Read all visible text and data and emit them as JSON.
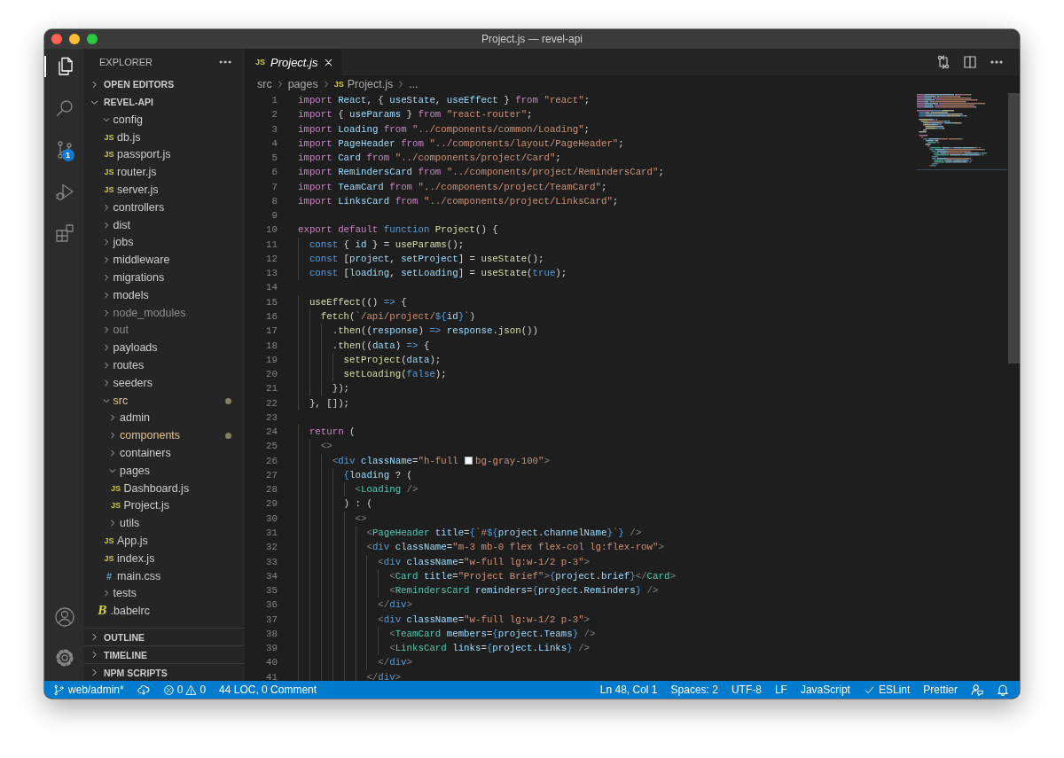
{
  "window": {
    "title": "Project.js — revel-api"
  },
  "activity_bar": {
    "items": [
      {
        "kind": "files",
        "selected": true
      },
      {
        "kind": "search",
        "selected": false
      },
      {
        "kind": "scm",
        "selected": false,
        "badge": "1"
      },
      {
        "kind": "debug",
        "selected": false
      },
      {
        "kind": "extensions",
        "selected": false
      }
    ],
    "bottom": [
      {
        "kind": "account"
      },
      {
        "kind": "settings"
      }
    ]
  },
  "sidebar": {
    "title": "EXPLORER",
    "sections": [
      {
        "title": "OPEN EDITORS",
        "expanded": false
      },
      {
        "title": "REVEL-API",
        "expanded": true,
        "tree": [
          {
            "name": "config",
            "kind": "folder",
            "expanded": true,
            "modified": false,
            "ignored": false,
            "children": [
              {
                "name": "db.js",
                "kind": "js",
                "icon": "JS",
                "modified": false,
                "ignored": false
              },
              {
                "name": "passport.js",
                "kind": "js",
                "icon": "JS",
                "modified": false,
                "ignored": false
              },
              {
                "name": "router.js",
                "kind": "js",
                "icon": "JS",
                "modified": false,
                "ignored": false
              },
              {
                "name": "server.js",
                "kind": "js",
                "icon": "JS",
                "modified": false,
                "ignored": false
              }
            ]
          },
          {
            "name": "controllers",
            "kind": "folder",
            "expanded": false,
            "modified": false,
            "ignored": false
          },
          {
            "name": "dist",
            "kind": "folder",
            "expanded": false,
            "modified": false,
            "ignored": false
          },
          {
            "name": "jobs",
            "kind": "folder",
            "expanded": false,
            "modified": false,
            "ignored": false
          },
          {
            "name": "middleware",
            "kind": "folder",
            "expanded": false,
            "modified": false,
            "ignored": false
          },
          {
            "name": "migrations",
            "kind": "folder",
            "expanded": false,
            "modified": false,
            "ignored": false
          },
          {
            "name": "models",
            "kind": "folder",
            "expanded": false,
            "modified": false,
            "ignored": false
          },
          {
            "name": "node_modules",
            "kind": "folder",
            "expanded": false,
            "modified": false,
            "ignored": true
          },
          {
            "name": "out",
            "kind": "folder",
            "expanded": false,
            "modified": false,
            "ignored": true
          },
          {
            "name": "payloads",
            "kind": "folder",
            "expanded": false,
            "modified": false,
            "ignored": false
          },
          {
            "name": "routes",
            "kind": "folder",
            "expanded": false,
            "modified": false,
            "ignored": false
          },
          {
            "name": "seeders",
            "kind": "folder",
            "expanded": false,
            "modified": false,
            "ignored": false
          },
          {
            "name": "src",
            "kind": "folder",
            "expanded": true,
            "modified": true,
            "ignored": false,
            "children": [
              {
                "name": "admin",
                "kind": "folder",
                "expanded": false,
                "modified": false,
                "ignored": false
              },
              {
                "name": "components",
                "kind": "folder",
                "expanded": false,
                "modified": true,
                "ignored": false
              },
              {
                "name": "containers",
                "kind": "folder",
                "expanded": false,
                "modified": false,
                "ignored": false
              },
              {
                "name": "pages",
                "kind": "folder",
                "expanded": true,
                "modified": false,
                "ignored": false,
                "children": [
                  {
                    "name": "Dashboard.js",
                    "kind": "js",
                    "icon": "JS",
                    "modified": false,
                    "ignored": false
                  },
                  {
                    "name": "Project.js",
                    "kind": "js",
                    "icon": "JS",
                    "modified": false,
                    "ignored": false
                  }
                ]
              },
              {
                "name": "utils",
                "kind": "folder",
                "expanded": false,
                "modified": false,
                "ignored": false
              },
              {
                "name": "App.js",
                "kind": "js",
                "icon": "JS",
                "modified": false,
                "ignored": false
              },
              {
                "name": "index.js",
                "kind": "js",
                "icon": "JS",
                "modified": false,
                "ignored": false
              },
              {
                "name": "main.css",
                "kind": "css",
                "icon": "#",
                "modified": false,
                "ignored": false
              }
            ]
          },
          {
            "name": "tests",
            "kind": "folder",
            "expanded": false,
            "modified": false,
            "ignored": false
          },
          {
            "name": ".babelrc",
            "kind": "babel",
            "icon": "B",
            "modified": false,
            "ignored": false
          }
        ]
      },
      {
        "title": "OUTLINE",
        "expanded": false
      },
      {
        "title": "TIMELINE",
        "expanded": false
      },
      {
        "title": "NPM SCRIPTS",
        "expanded": false
      }
    ]
  },
  "editor": {
    "tabs": [
      {
        "label": "Project.js",
        "icon": "JS",
        "selected": true,
        "preview": true
      }
    ],
    "actions": [
      {
        "kind": "compare"
      },
      {
        "kind": "split"
      },
      {
        "kind": "more"
      }
    ],
    "breadcrumbs": [
      {
        "label": "src"
      },
      {
        "label": "pages"
      },
      {
        "label": "Project.js",
        "icon": "JS"
      },
      {
        "label": "..."
      }
    ],
    "lines": [
      {
        "number": "1",
        "tokens": [
          {
            "kind": "kw",
            "text": "import "
          },
          {
            "kind": "var",
            "text": "React"
          },
          {
            "kind": "txt",
            "text": ", { "
          },
          {
            "kind": "var",
            "text": "useState"
          },
          {
            "kind": "txt",
            "text": ", "
          },
          {
            "kind": "var",
            "text": "useEffect"
          },
          {
            "kind": "txt",
            "text": " } "
          },
          {
            "kind": "kw",
            "text": "from "
          },
          {
            "kind": "str",
            "text": "\"react\""
          },
          {
            "kind": "txt",
            "text": ";"
          }
        ]
      },
      {
        "number": "2",
        "tokens": [
          {
            "kind": "kw",
            "text": "import "
          },
          {
            "kind": "txt",
            "text": "{ "
          },
          {
            "kind": "var",
            "text": "useParams"
          },
          {
            "kind": "txt",
            "text": " } "
          },
          {
            "kind": "kw",
            "text": "from "
          },
          {
            "kind": "str",
            "text": "\"react-router\""
          },
          {
            "kind": "txt",
            "text": ";"
          }
        ]
      },
      {
        "number": "3",
        "tokens": [
          {
            "kind": "kw",
            "text": "import "
          },
          {
            "kind": "var",
            "text": "Loading"
          },
          {
            "kind": "kw",
            "text": " from "
          },
          {
            "kind": "str",
            "text": "\"../components/common/Loading\""
          },
          {
            "kind": "txt",
            "text": ";"
          }
        ]
      },
      {
        "number": "4",
        "tokens": [
          {
            "kind": "kw",
            "text": "import "
          },
          {
            "kind": "var",
            "text": "PageHeader"
          },
          {
            "kind": "kw",
            "text": " from "
          },
          {
            "kind": "str",
            "text": "\"../components/layout/PageHeader\""
          },
          {
            "kind": "txt",
            "text": ";"
          }
        ]
      },
      {
        "number": "5",
        "tokens": [
          {
            "kind": "kw",
            "text": "import "
          },
          {
            "kind": "var",
            "text": "Card"
          },
          {
            "kind": "kw",
            "text": " from "
          },
          {
            "kind": "str",
            "text": "\"../components/project/Card\""
          },
          {
            "kind": "txt",
            "text": ";"
          }
        ]
      },
      {
        "number": "6",
        "tokens": [
          {
            "kind": "kw",
            "text": "import "
          },
          {
            "kind": "var",
            "text": "RemindersCard"
          },
          {
            "kind": "kw",
            "text": " from "
          },
          {
            "kind": "str",
            "text": "\"../components/project/RemindersCard\""
          },
          {
            "kind": "txt",
            "text": ";"
          }
        ]
      },
      {
        "number": "7",
        "tokens": [
          {
            "kind": "kw",
            "text": "import "
          },
          {
            "kind": "var",
            "text": "TeamCard"
          },
          {
            "kind": "kw",
            "text": " from "
          },
          {
            "kind": "str",
            "text": "\"../components/project/TeamCard\""
          },
          {
            "kind": "txt",
            "text": ";"
          }
        ]
      },
      {
        "number": "8",
        "tokens": [
          {
            "kind": "kw",
            "text": "import "
          },
          {
            "kind": "var",
            "text": "LinksCard"
          },
          {
            "kind": "kw",
            "text": " from "
          },
          {
            "kind": "str",
            "text": "\"../components/project/LinksCard\""
          },
          {
            "kind": "txt",
            "text": ";"
          }
        ]
      },
      {
        "number": "9"
      },
      {
        "number": "10",
        "tokens": [
          {
            "kind": "kw",
            "text": "export default "
          },
          {
            "kind": "st",
            "text": "function "
          },
          {
            "kind": "fn",
            "text": "Project"
          },
          {
            "kind": "txt",
            "text": "() {"
          }
        ]
      },
      {
        "number": "11",
        "tokens": [
          {
            "kind": "st",
            "text": "  const "
          },
          {
            "kind": "txt",
            "text": "{ "
          },
          {
            "kind": "var",
            "text": "id"
          },
          {
            "kind": "txt",
            "text": " } = "
          },
          {
            "kind": "fn",
            "text": "useParams"
          },
          {
            "kind": "txt",
            "text": "();"
          }
        ]
      },
      {
        "number": "12",
        "tokens": [
          {
            "kind": "st",
            "text": "  const "
          },
          {
            "kind": "txt",
            "text": "["
          },
          {
            "kind": "var",
            "text": "project"
          },
          {
            "kind": "txt",
            "text": ", "
          },
          {
            "kind": "var",
            "text": "setProject"
          },
          {
            "kind": "txt",
            "text": "] = "
          },
          {
            "kind": "fn",
            "text": "useState"
          },
          {
            "kind": "txt",
            "text": "();"
          }
        ]
      },
      {
        "number": "13",
        "tokens": [
          {
            "kind": "st",
            "text": "  const "
          },
          {
            "kind": "txt",
            "text": "["
          },
          {
            "kind": "var",
            "text": "loading"
          },
          {
            "kind": "txt",
            "text": ", "
          },
          {
            "kind": "var",
            "text": "setLoading"
          },
          {
            "kind": "txt",
            "text": "] = "
          },
          {
            "kind": "fn",
            "text": "useState"
          },
          {
            "kind": "txt",
            "text": "("
          },
          {
            "kind": "st",
            "text": "true"
          },
          {
            "kind": "txt",
            "text": ");"
          }
        ]
      },
      {
        "number": "14"
      },
      {
        "number": "15",
        "tokens": [
          {
            "kind": "fn",
            "text": "  useEffect"
          },
          {
            "kind": "txt",
            "text": "(() "
          },
          {
            "kind": "st",
            "text": "=>"
          },
          {
            "kind": "txt",
            "text": " {"
          }
        ]
      },
      {
        "number": "16",
        "tokens": [
          {
            "kind": "fn",
            "text": "    fetch"
          },
          {
            "kind": "txt",
            "text": "("
          },
          {
            "kind": "str",
            "text": "`/api/project/"
          },
          {
            "kind": "st",
            "text": "${"
          },
          {
            "kind": "var",
            "text": "id"
          },
          {
            "kind": "st",
            "text": "}"
          },
          {
            "kind": "str",
            "text": "`"
          },
          {
            "kind": "txt",
            "text": ")"
          }
        ]
      },
      {
        "number": "17",
        "tokens": [
          {
            "kind": "txt",
            "text": "      ."
          },
          {
            "kind": "fn",
            "text": "then"
          },
          {
            "kind": "txt",
            "text": "(("
          },
          {
            "kind": "var",
            "text": "response"
          },
          {
            "kind": "txt",
            "text": ") "
          },
          {
            "kind": "st",
            "text": "=>"
          },
          {
            "kind": "var",
            "text": " response"
          },
          {
            "kind": "txt",
            "text": "."
          },
          {
            "kind": "fn",
            "text": "json"
          },
          {
            "kind": "txt",
            "text": "())"
          }
        ]
      },
      {
        "number": "18",
        "tokens": [
          {
            "kind": "txt",
            "text": "      ."
          },
          {
            "kind": "fn",
            "text": "then"
          },
          {
            "kind": "txt",
            "text": "(("
          },
          {
            "kind": "var",
            "text": "data"
          },
          {
            "kind": "txt",
            "text": ") "
          },
          {
            "kind": "st",
            "text": "=>"
          },
          {
            "kind": "txt",
            "text": " {"
          }
        ]
      },
      {
        "number": "19",
        "tokens": [
          {
            "kind": "fn",
            "text": "        setProject"
          },
          {
            "kind": "txt",
            "text": "("
          },
          {
            "kind": "var",
            "text": "data"
          },
          {
            "kind": "txt",
            "text": ");"
          }
        ]
      },
      {
        "number": "20",
        "tokens": [
          {
            "kind": "fn",
            "text": "        setLoading"
          },
          {
            "kind": "txt",
            "text": "("
          },
          {
            "kind": "st",
            "text": "false"
          },
          {
            "kind": "txt",
            "text": ");"
          }
        ]
      },
      {
        "number": "21",
        "tokens": [
          {
            "kind": "txt",
            "text": "      });"
          }
        ]
      },
      {
        "number": "22",
        "tokens": [
          {
            "kind": "txt",
            "text": "  }, []);"
          }
        ]
      },
      {
        "number": "23"
      },
      {
        "number": "24",
        "tokens": [
          {
            "kind": "kw",
            "text": "  return "
          },
          {
            "kind": "txt",
            "text": "("
          }
        ]
      },
      {
        "number": "25",
        "tokens": [
          {
            "kind": "pun",
            "text": "    <>"
          }
        ]
      },
      {
        "number": "26",
        "tokens": [
          {
            "kind": "pun",
            "text": "      <"
          },
          {
            "kind": "html",
            "text": "div"
          },
          {
            "kind": "var",
            "text": " className"
          },
          {
            "kind": "txt",
            "text": "="
          },
          {
            "kind": "str",
            "text": "\"h-full "
          },
          {
            "kind": "swatch",
            "color": "#f7fafc"
          },
          {
            "kind": "str",
            "text": "bg-gray-100\""
          },
          {
            "kind": "pun",
            "text": ">"
          }
        ]
      },
      {
        "number": "27",
        "tokens": [
          {
            "kind": "st",
            "text": "        {"
          },
          {
            "kind": "var",
            "text": "loading"
          },
          {
            "kind": "txt",
            "text": " ? ("
          }
        ]
      },
      {
        "number": "28",
        "tokens": [
          {
            "kind": "pun",
            "text": "          <"
          },
          {
            "kind": "tag",
            "text": "Loading"
          },
          {
            "kind": "pun",
            "text": " />"
          }
        ]
      },
      {
        "number": "29",
        "tokens": [
          {
            "kind": "txt",
            "text": "        ) : ("
          }
        ]
      },
      {
        "number": "30",
        "tokens": [
          {
            "kind": "pun",
            "text": "          <>"
          }
        ]
      },
      {
        "number": "31",
        "tokens": [
          {
            "kind": "pun",
            "text": "            <"
          },
          {
            "kind": "tag",
            "text": "PageHeader"
          },
          {
            "kind": "var",
            "text": " title"
          },
          {
            "kind": "txt",
            "text": "="
          },
          {
            "kind": "st",
            "text": "{"
          },
          {
            "kind": "str",
            "text": "`#"
          },
          {
            "kind": "st",
            "text": "${"
          },
          {
            "kind": "var",
            "text": "project"
          },
          {
            "kind": "txt",
            "text": "."
          },
          {
            "kind": "var",
            "text": "channelName"
          },
          {
            "kind": "st",
            "text": "}"
          },
          {
            "kind": "str",
            "text": "`"
          },
          {
            "kind": "st",
            "text": "}"
          },
          {
            "kind": "pun",
            "text": " />"
          }
        ]
      },
      {
        "number": "32",
        "tokens": [
          {
            "kind": "pun",
            "text": "            <"
          },
          {
            "kind": "html",
            "text": "div"
          },
          {
            "kind": "var",
            "text": " className"
          },
          {
            "kind": "txt",
            "text": "="
          },
          {
            "kind": "str",
            "text": "\"m-3 mb-0 flex flex-col lg:flex-row\""
          },
          {
            "kind": "pun",
            "text": ">"
          }
        ]
      },
      {
        "number": "33",
        "tokens": [
          {
            "kind": "pun",
            "text": "              <"
          },
          {
            "kind": "html",
            "text": "div"
          },
          {
            "kind": "var",
            "text": " className"
          },
          {
            "kind": "txt",
            "text": "="
          },
          {
            "kind": "str",
            "text": "\"w-full lg:w-1/2 p-3\""
          },
          {
            "kind": "pun",
            "text": ">"
          }
        ]
      },
      {
        "number": "34",
        "tokens": [
          {
            "kind": "pun",
            "text": "                <"
          },
          {
            "kind": "tag",
            "text": "Card"
          },
          {
            "kind": "var",
            "text": " title"
          },
          {
            "kind": "txt",
            "text": "="
          },
          {
            "kind": "str",
            "text": "\"Project Brief\""
          },
          {
            "kind": "pun",
            "text": ">"
          },
          {
            "kind": "st",
            "text": "{"
          },
          {
            "kind": "var",
            "text": "project"
          },
          {
            "kind": "txt",
            "text": "."
          },
          {
            "kind": "var",
            "text": "brief"
          },
          {
            "kind": "st",
            "text": "}"
          },
          {
            "kind": "pun",
            "text": "</"
          },
          {
            "kind": "tag",
            "text": "Card"
          },
          {
            "kind": "pun",
            "text": ">"
          }
        ]
      },
      {
        "number": "35",
        "tokens": [
          {
            "kind": "pun",
            "text": "                <"
          },
          {
            "kind": "tag",
            "text": "RemindersCard"
          },
          {
            "kind": "var",
            "text": " reminders"
          },
          {
            "kind": "txt",
            "text": "="
          },
          {
            "kind": "st",
            "text": "{"
          },
          {
            "kind": "var",
            "text": "project"
          },
          {
            "kind": "txt",
            "text": "."
          },
          {
            "kind": "var",
            "text": "Reminders"
          },
          {
            "kind": "st",
            "text": "}"
          },
          {
            "kind": "pun",
            "text": " />"
          }
        ]
      },
      {
        "number": "36",
        "tokens": [
          {
            "kind": "pun",
            "text": "              </"
          },
          {
            "kind": "html",
            "text": "div"
          },
          {
            "kind": "pun",
            "text": ">"
          }
        ]
      },
      {
        "number": "37",
        "tokens": [
          {
            "kind": "pun",
            "text": "              <"
          },
          {
            "kind": "html",
            "text": "div"
          },
          {
            "kind": "var",
            "text": " className"
          },
          {
            "kind": "txt",
            "text": "="
          },
          {
            "kind": "str",
            "text": "\"w-full lg:w-1/2 p-3\""
          },
          {
            "kind": "pun",
            "text": ">"
          }
        ]
      },
      {
        "number": "38",
        "tokens": [
          {
            "kind": "pun",
            "text": "                <"
          },
          {
            "kind": "tag",
            "text": "TeamCard"
          },
          {
            "kind": "var",
            "text": " members"
          },
          {
            "kind": "txt",
            "text": "="
          },
          {
            "kind": "st",
            "text": "{"
          },
          {
            "kind": "var",
            "text": "project"
          },
          {
            "kind": "txt",
            "text": "."
          },
          {
            "kind": "var",
            "text": "Teams"
          },
          {
            "kind": "st",
            "text": "}"
          },
          {
            "kind": "pun",
            "text": " />"
          }
        ]
      },
      {
        "number": "39",
        "tokens": [
          {
            "kind": "pun",
            "text": "                <"
          },
          {
            "kind": "tag",
            "text": "LinksCard"
          },
          {
            "kind": "var",
            "text": " links"
          },
          {
            "kind": "txt",
            "text": "="
          },
          {
            "kind": "st",
            "text": "{"
          },
          {
            "kind": "var",
            "text": "project"
          },
          {
            "kind": "txt",
            "text": "."
          },
          {
            "kind": "var",
            "text": "Links"
          },
          {
            "kind": "st",
            "text": "}"
          },
          {
            "kind": "pun",
            "text": " />"
          }
        ]
      },
      {
        "number": "40",
        "tokens": [
          {
            "kind": "pun",
            "text": "              </"
          },
          {
            "kind": "html",
            "text": "div"
          },
          {
            "kind": "pun",
            "text": ">"
          }
        ]
      },
      {
        "number": "41",
        "tokens": [
          {
            "kind": "pun",
            "text": "            </"
          },
          {
            "kind": "html",
            "text": "div"
          },
          {
            "kind": "pun",
            "text": ">"
          }
        ]
      }
    ]
  },
  "status_bar": {
    "left": [
      {
        "kind": "branch",
        "text": "web/admin*"
      },
      {
        "kind": "sync"
      },
      {
        "kind": "problems",
        "errors": "0",
        "warnings": "0"
      },
      {
        "kind": "text",
        "text": "44 LOC, 0 Comment"
      }
    ],
    "right": [
      {
        "kind": "text",
        "text": "Ln 48, Col 1"
      },
      {
        "kind": "text",
        "text": "Spaces: 2"
      },
      {
        "kind": "text",
        "text": "UTF-8"
      },
      {
        "kind": "text",
        "text": "LF"
      },
      {
        "kind": "text",
        "text": "JavaScript"
      },
      {
        "kind": "check",
        "text": "ESLint"
      },
      {
        "kind": "text",
        "text": "Prettier"
      },
      {
        "kind": "feedback"
      },
      {
        "kind": "bell"
      }
    ]
  }
}
